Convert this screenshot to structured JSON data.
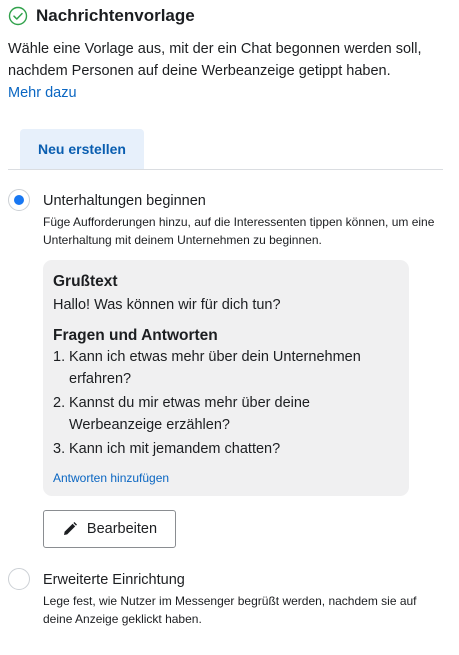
{
  "header": {
    "title": "Nachrichtenvorlage",
    "description": "Wähle eine Vorlage aus, mit der ein Chat begonnen werden soll, nachdem Personen auf deine Werbeanzeige getippt haben.",
    "learn_more": "Mehr dazu",
    "status_icon": "check-circle-icon",
    "accent_color": "#1877f2"
  },
  "create_button": {
    "label": "Neu erstellen"
  },
  "options": [
    {
      "title": "Unterhaltungen beginnen",
      "description": "Füge Aufforderungen hinzu, auf die Interessenten tippen können, um eine Unterhaltung mit deinem Unternehmen zu beginnen.",
      "selected": true
    },
    {
      "title": "Erweiterte Einrichtung",
      "description": "Lege fest, wie Nutzer im Messenger begrüßt werden, nachdem sie auf deine Anzeige geklickt haben.",
      "selected": false
    }
  ],
  "card": {
    "greeting_heading": "Grußtext",
    "greeting_text": "Hallo! Was können wir für dich tun?",
    "qa_heading": "Fragen und Antworten",
    "questions": [
      {
        "num": "1.",
        "text": "Kann ich etwas mehr über dein Unternehmen erfahren?"
      },
      {
        "num": "2.",
        "text": "Kannst du mir etwas mehr über deine Werbeanzeige erzählen?"
      },
      {
        "num": "3.",
        "text": "Kann ich mit jemandem chatten?"
      }
    ],
    "add_answers": "Antworten hinzufügen"
  },
  "edit_button": {
    "label": "Bearbeiten",
    "icon": "pencil-icon"
  }
}
